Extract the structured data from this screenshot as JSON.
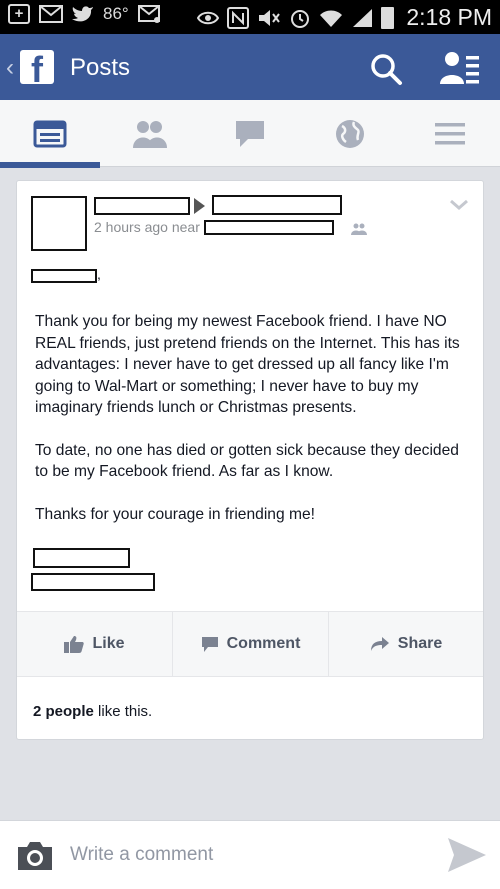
{
  "status_bar": {
    "temperature": "86°",
    "time": "2:18 PM"
  },
  "app_bar": {
    "logo_letter": "f",
    "title": "Posts"
  },
  "tabs": [
    {
      "icon": "news-feed-icon",
      "active": true
    },
    {
      "icon": "friend-requests-icon",
      "active": false
    },
    {
      "icon": "messages-icon",
      "active": false
    },
    {
      "icon": "notifications-globe-icon",
      "active": false
    },
    {
      "icon": "more-menu-icon",
      "active": false
    }
  ],
  "post": {
    "time_text": "2 hours ago near",
    "comma": ",",
    "paragraphs": [
      "Thank you for being my newest Facebook friend. I have NO REAL friends, just pretend friends on the Internet. This has its advantages: I never have to get dressed up all fancy like I'm going to Wal-Mart or something; I never have to buy my imaginary friends lunch or Christmas presents.",
      "To date, no one has died or gotten sick because they decided to be my Facebook friend. As far as I know.",
      "Thanks for your courage in friending me!"
    ],
    "actions": {
      "like": "Like",
      "comment": "Comment",
      "share": "Share"
    },
    "likes_count_text": "2 people",
    "likes_suffix": " like this."
  },
  "comment_bar": {
    "placeholder": "Write a comment"
  },
  "colors": {
    "brand": "#3b5998",
    "tab_icon": "#aab0bd",
    "text": "#141823",
    "muted": "#8a8d91"
  }
}
